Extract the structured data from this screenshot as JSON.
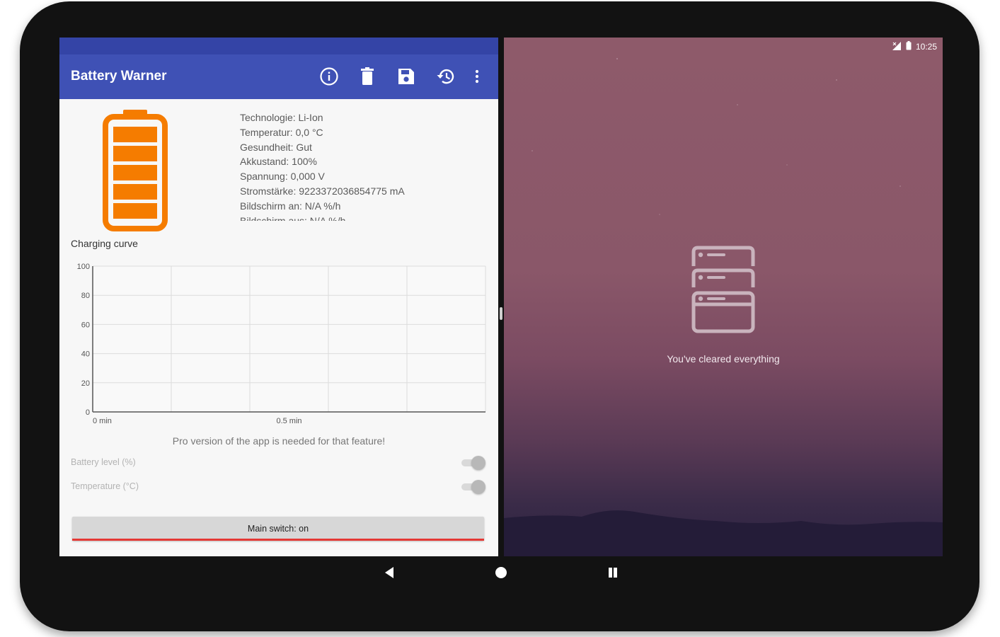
{
  "app": {
    "title": "Battery Warner",
    "toolbar_icons": [
      "info-icon",
      "delete-icon",
      "save-icon",
      "history-icon",
      "more-vert-icon"
    ],
    "colors": {
      "primary": "#3f51b5",
      "primary_dark": "#3444a6",
      "battery": "#f57c00",
      "switch_indicator": "#e53935"
    },
    "battery_icon": "battery-full-icon",
    "info": [
      "Technologie: Li-Ion",
      "Temperatur: 0,0 °C",
      "Gesundheit: Gut",
      "Akkustand: 100%",
      "Spannung: 0,000 V",
      "Stromstärke: 9223372036854775 mA",
      "Bildschirm an: N/A %/h",
      "Bildschirm aus: N/A %/h"
    ],
    "chart_section_title": "Charging curve",
    "pro_message": "Pro version of the app is needed for that feature!",
    "settings": [
      {
        "label": "Battery level (%)",
        "enabled": true
      },
      {
        "label": "Temperature (°C)",
        "enabled": true
      }
    ],
    "main_switch_label": "Main switch: on"
  },
  "chart_data": {
    "type": "line",
    "title": "Charging curve",
    "xlabel": "",
    "ylabel": "",
    "x_tick_labels": [
      "0 min",
      "0.5 min"
    ],
    "y_tick_labels": [
      "0",
      "20",
      "40",
      "60",
      "80",
      "100"
    ],
    "ylim": [
      0,
      100
    ],
    "grid": true,
    "series": []
  },
  "recents": {
    "empty_text": "You've cleared everything",
    "empty_icon": "stacked-cards-icon"
  },
  "status_bar": {
    "time": "10:25",
    "icons": [
      "signal-icon",
      "battery-icon"
    ]
  },
  "navigation": {
    "buttons": [
      "back-icon",
      "home-icon",
      "recents-icon"
    ]
  }
}
